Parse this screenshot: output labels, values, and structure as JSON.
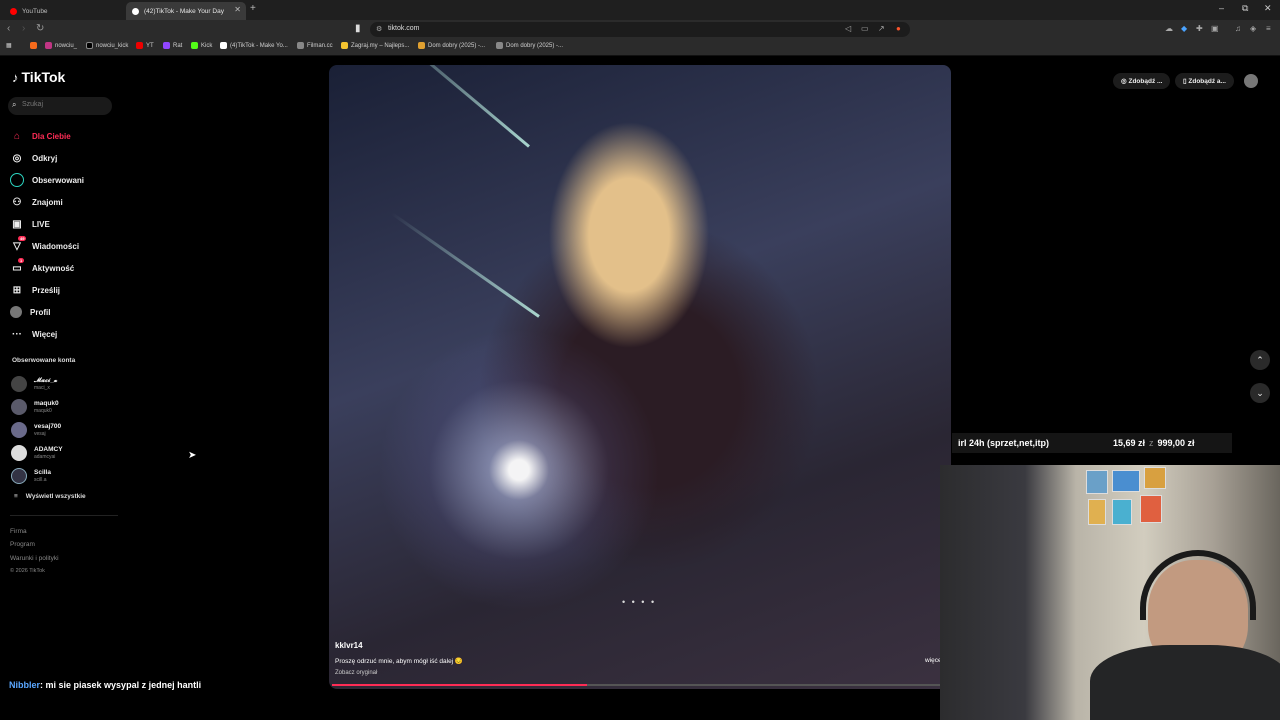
{
  "browser": {
    "tabs": [
      {
        "label": "YouTube",
        "active": false
      },
      {
        "label": "(42)TikTok - Make Your Day",
        "active": true
      }
    ],
    "url": "tiktok.com",
    "bookmarks": [
      "nowciu_",
      "nowciu_kick",
      "YT",
      "Rat",
      "Kick",
      "(4)TikTok - Make Yo...",
      "Filman.cc",
      "Zagraj.my – Najleps...",
      "Dom dobry (2025) -...",
      "Dom dobry (2025) -..."
    ]
  },
  "tiktok": {
    "logo": "TikTok",
    "search_placeholder": "Szukaj",
    "nav": [
      {
        "label": "Dla Ciebie",
        "icon": "home-icon",
        "active": true
      },
      {
        "label": "Odkryj",
        "icon": "compass-icon"
      },
      {
        "label": "Obserwowani",
        "icon": "following-icon"
      },
      {
        "label": "Znajomi",
        "icon": "friends-icon"
      },
      {
        "label": "LIVE",
        "icon": "live-icon"
      },
      {
        "label": "Wiadomości",
        "icon": "messages-icon",
        "badge": "49"
      },
      {
        "label": "Aktywność",
        "icon": "activity-icon",
        "badge": "1"
      },
      {
        "label": "Prześlij",
        "icon": "upload-icon"
      },
      {
        "label": "Profil",
        "icon": "profile-icon"
      },
      {
        "label": "Więcej",
        "icon": "more-icon"
      }
    ],
    "followed_title": "Obserwowane konta",
    "accounts": [
      {
        "name": "𝓜𝓪𝓬𝓲_𝔁",
        "handle": "maci_x"
      },
      {
        "name": "maquk0",
        "handle": "maquk0"
      },
      {
        "name": "vesaj700",
        "handle": "vesaj"
      },
      {
        "name": "ADAMCY",
        "handle": "adamcyai"
      },
      {
        "name": "Scilla",
        "handle": "scill.a"
      }
    ],
    "show_all": "Wyświetl wszystkie",
    "footer": [
      "Firma",
      "Program",
      "Warunki i polityki"
    ],
    "copyright": "© 2026 TikTok",
    "top_buttons": [
      "Zdobądź ...",
      "Zdobądź a..."
    ],
    "video": {
      "author": "kklvr14",
      "description": "Proszę odrzuć mnie, abym mógł iść dalej 😔",
      "see_original": "Zobacz oryginał",
      "more": "więcej",
      "progress": 0.42
    }
  },
  "stream": {
    "goal_title": "irl 24h (sprzet,net,itp)",
    "goal_current": "15,69 zł",
    "goal_separator": "z",
    "goal_target": "999,00 zł",
    "chat_user": "Nibbler",
    "chat_message": ": mi sie piasek wysypal z jednej hantli"
  },
  "colors": {
    "accent": "#fe2c55",
    "chat_user": "#5aa7ff"
  }
}
